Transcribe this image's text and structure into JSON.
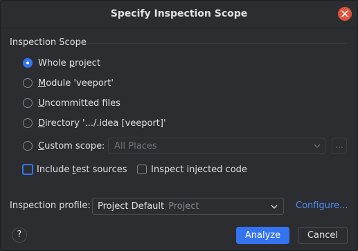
{
  "dialog": {
    "title": "Specify Inspection Scope"
  },
  "scope": {
    "section_label": "Inspection Scope",
    "options": [
      {
        "pre": "Whole ",
        "mnemonic": "p",
        "post": "roject",
        "selected": true
      },
      {
        "pre": "",
        "mnemonic": "M",
        "post": "odule 'veeport'",
        "selected": false
      },
      {
        "pre": "",
        "mnemonic": "U",
        "post": "ncommitted files",
        "selected": false
      },
      {
        "pre": "",
        "mnemonic": "D",
        "post": "irectory '.../.idea [veeport]'",
        "selected": false
      },
      {
        "pre": "",
        "mnemonic": "C",
        "post": "ustom scope:",
        "selected": false
      }
    ],
    "custom_scope_value": "All Places",
    "browse_label": "...",
    "include_test_sources": {
      "pre": "Include ",
      "mnemonic": "t",
      "post": "est sources",
      "checked": false
    },
    "inspect_injected_code": {
      "label": "Inspect injected code",
      "checked": false
    }
  },
  "profile": {
    "label": "Inspection profile:",
    "name": "Project Default",
    "type": "Project",
    "configure_label": "Configure..."
  },
  "footer": {
    "help_label": "?",
    "analyze_label": "Analyze",
    "cancel_label": "Cancel"
  },
  "colors": {
    "background": "#2b2d30",
    "accent": "#3574f0",
    "close_button": "#e0533c",
    "link": "#548af7"
  },
  "icons": {
    "close": "close-icon",
    "dropdown": "chevron-down-icon",
    "help": "help-icon"
  }
}
